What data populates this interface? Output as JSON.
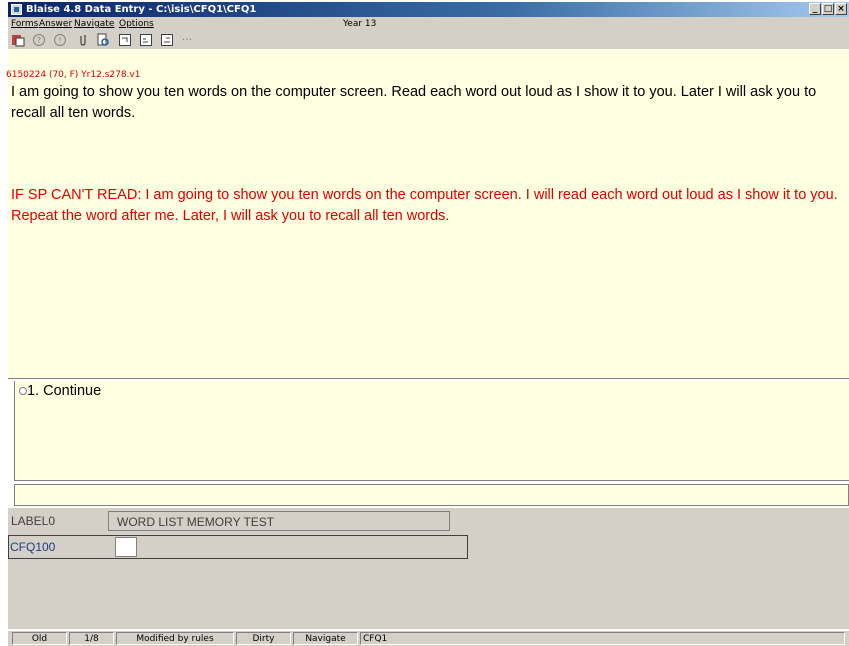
{
  "window": {
    "title": "Blaise 4.8 Data Entry - C:\\isis\\CFQ1\\CFQ1",
    "controls": [
      "minimize-icon",
      "maximize-icon",
      "close-icon"
    ]
  },
  "menu": {
    "items": [
      "Forms",
      "Answer",
      "Navigate",
      "Options"
    ],
    "context_label": "Year 13"
  },
  "toolbar": {
    "icons": [
      "save-form-icon",
      "help-icon",
      "remark-icon",
      "attachment-icon",
      "find-icon",
      "next-field-icon",
      "previous-field-icon",
      "next-page-icon",
      "more-icon"
    ]
  },
  "question": {
    "id_line": "6150224 (70, F)  Yr12.s278.v1",
    "text": "I am going to show you ten words on the computer screen.  Read each word out loud as I show it to you.  Later I will ask you to recall all ten words.",
    "instruction": "IF SP CAN'T READ: I am going to show you ten words on the computer screen.  I will read each word out loud as I show it to you.  Repeat the word after me.  Later, I will ask you to recall all ten words.",
    "color_instruction": "#e00000"
  },
  "answers": {
    "options": [
      "1. Continue"
    ]
  },
  "form_pane": {
    "rows": [
      {
        "name": "LABEL0",
        "value": "WORD LIST MEMORY TEST"
      },
      {
        "name": "CFQ100",
        "value": ""
      }
    ]
  },
  "status_bar": {
    "items": [
      "Old",
      "1/8",
      "Modified by rules",
      "Dirty",
      "Navigate",
      "CFQ1"
    ]
  }
}
